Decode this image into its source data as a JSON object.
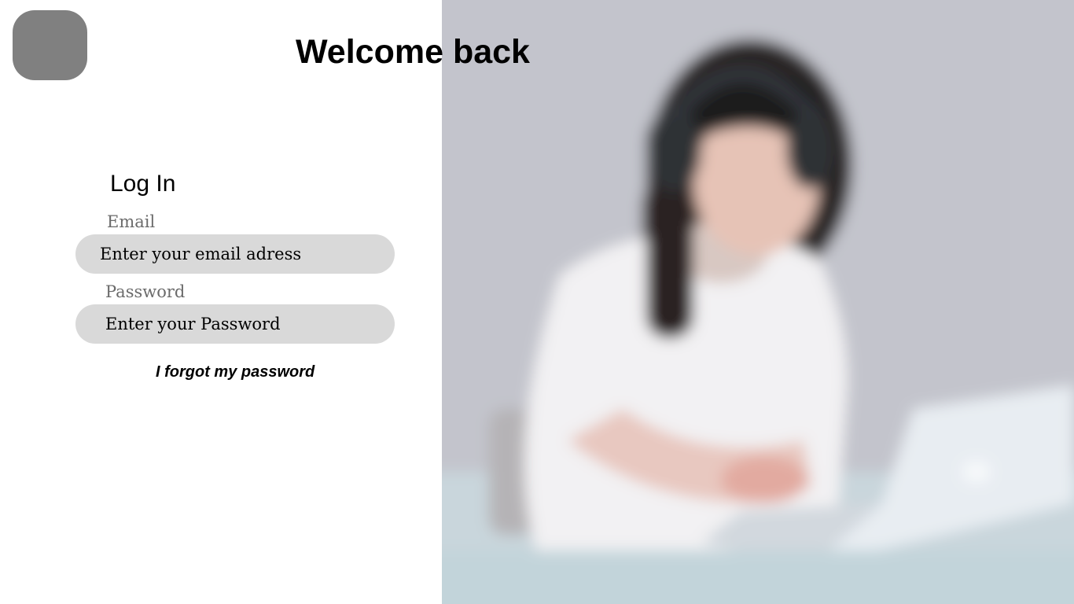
{
  "header": {
    "title": "Welcome back"
  },
  "logo": {
    "color": "#808080"
  },
  "login": {
    "title": "Log In",
    "email": {
      "label": "Email",
      "placeholder": "Enter your email adress",
      "value": ""
    },
    "password": {
      "label": "Password",
      "placeholder": "Enter your Password",
      "value": ""
    },
    "forgot_link": "I forgot my password"
  },
  "colors": {
    "background": "#ffffff",
    "input_background": "#d9d9d9",
    "label_text": "#6b6b6b",
    "logo_placeholder": "#808080"
  }
}
